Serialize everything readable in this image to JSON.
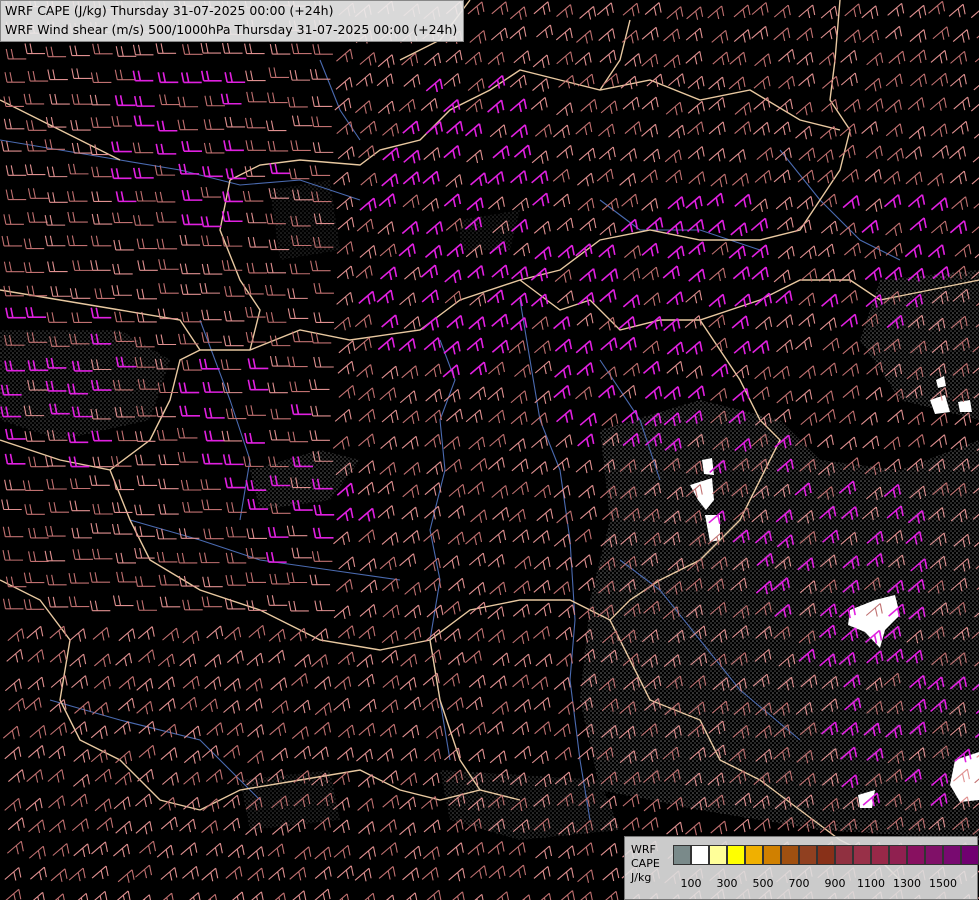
{
  "title": {
    "line1": "WRF CAPE (J/kg) Thursday 31-07-2025 00:00 (+24h)",
    "line2": "WRF Wind shear (m/s) 500/1000hPa Thursday 31-07-2025 00:00 (+24h)"
  },
  "legend": {
    "label_model": "WRF",
    "label_field": "CAPE",
    "label_unit": "J/kg",
    "swatch_colors": [
      "#7a8a8a",
      "#ffffff",
      "#ffff99",
      "#ffff00",
      "#f0b000",
      "#d08000",
      "#a05010",
      "#904020",
      "#883018",
      "#903040",
      "#983048",
      "#982848",
      "#902050",
      "#881060",
      "#801068",
      "#780a70",
      "#700070"
    ],
    "ticks": [
      "100",
      "300",
      "500",
      "700",
      "900",
      "1100",
      "1300",
      "1500"
    ]
  },
  "colors": {
    "background": "#000000",
    "borders": "#e8c8a0",
    "rivers": "#4a6ab0",
    "barb_low": "#c07070",
    "barb_mid": "#e09090",
    "barb_high": "#e020e0",
    "cape_stipple": "#8a8a8a",
    "cape_white": "#ffffff"
  }
}
